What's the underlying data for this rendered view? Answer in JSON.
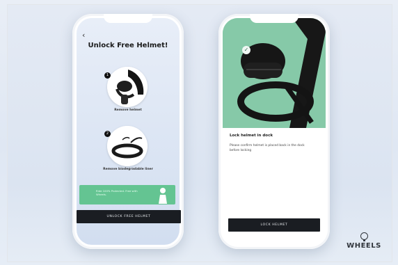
{
  "left_screen": {
    "back_icon": "chevron-left-icon",
    "back_glyph": "‹",
    "title": "Unlock Free Helmet!",
    "steps": [
      {
        "number": "1",
        "caption": "Remove helmet"
      },
      {
        "number": "2",
        "caption": "Remove biodegradable liner"
      }
    ],
    "promo_text": "Ride 100% Protected. Free with Wheels.",
    "button_label": "UNLOCK FREE HELMET"
  },
  "right_screen": {
    "check_glyph": "✓",
    "title": "Lock helmet in dock",
    "description": "Please confirm helmet is placed back in the dock before locking",
    "button_label": "LOCK HELMET"
  },
  "brand": {
    "name": "WHEELS"
  },
  "colors": {
    "accent_green": "#64c492",
    "hero_green": "#86c9a8",
    "button_dark": "#1a1d22"
  }
}
